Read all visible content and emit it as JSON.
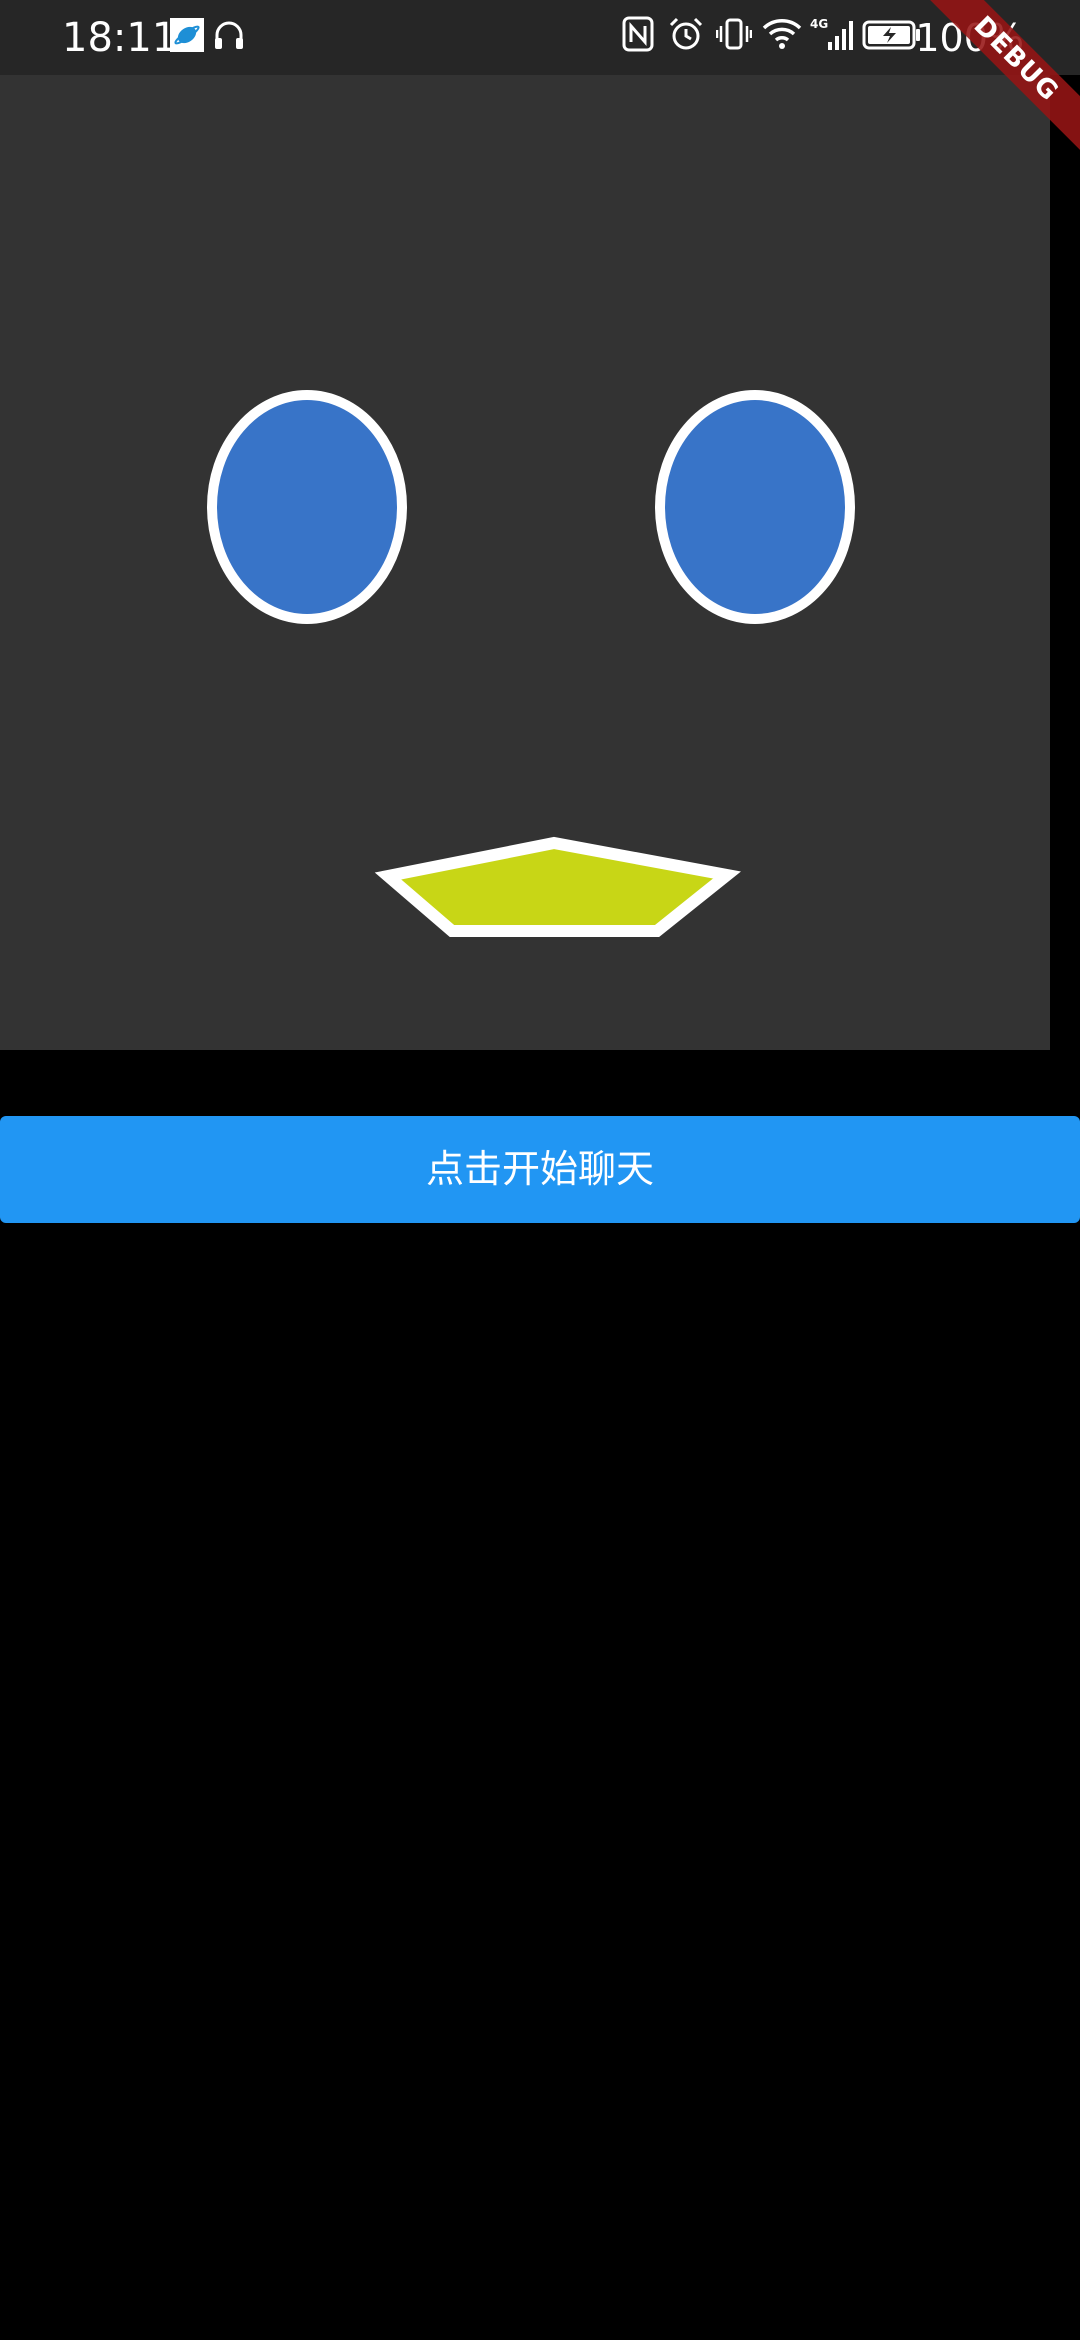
{
  "status_bar": {
    "time": "18:11",
    "left_icons": [
      "app-notification-icon",
      "headphones-icon"
    ],
    "right_icons": [
      "nfc-icon",
      "alarm-icon",
      "vibrate-icon",
      "wifi-icon",
      "signal-4g-icon",
      "battery-charging-icon"
    ],
    "network_label": "4G",
    "battery_percent": "100%"
  },
  "face": {
    "background_color": "#333333",
    "eye_color": "#3874c8",
    "eye_outline_color": "#ffffff",
    "mouth_color": "#c8d616",
    "mouth_outline_color": "#ffffff"
  },
  "chat_button": {
    "label": "点击开始聊天",
    "color": "#2196f3"
  },
  "debug_banner": {
    "label": "DEBUG"
  }
}
